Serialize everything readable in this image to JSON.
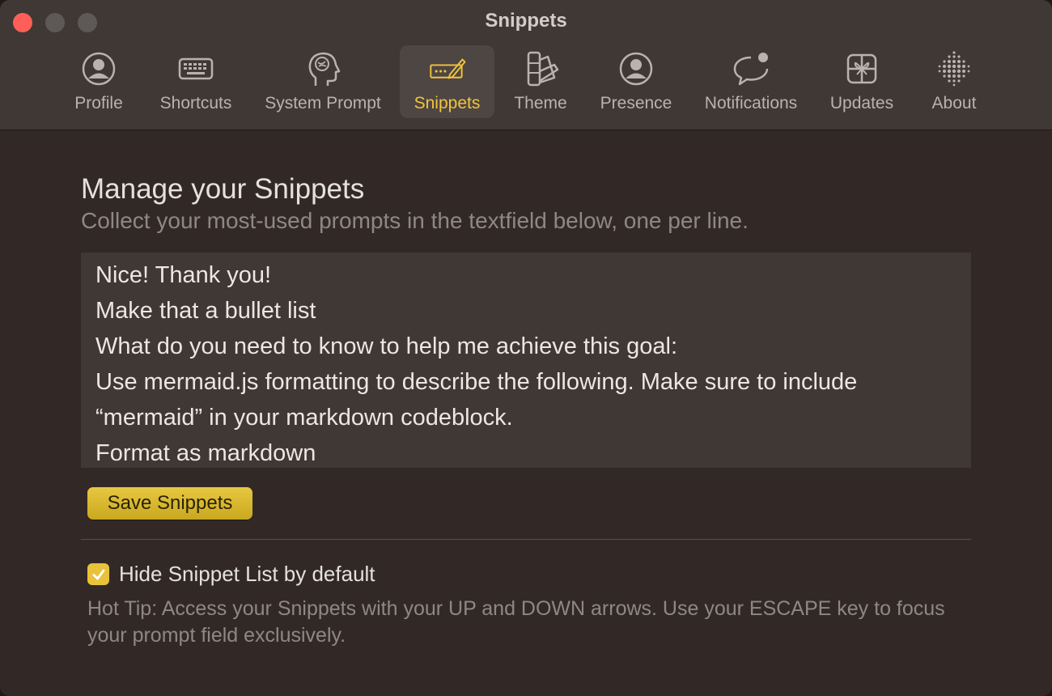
{
  "window": {
    "title": "Snippets"
  },
  "tabs": [
    {
      "label": "Profile",
      "icon": "person-circle-icon"
    },
    {
      "label": "Shortcuts",
      "icon": "keyboard-icon"
    },
    {
      "label": "System Prompt",
      "icon": "head-brain-icon"
    },
    {
      "label": "Snippets",
      "icon": "pen-text-icon",
      "active": true
    },
    {
      "label": "Theme",
      "icon": "swatches-icon"
    },
    {
      "label": "Presence",
      "icon": "person-circle-icon"
    },
    {
      "label": "Notifications",
      "icon": "chat-bubble-badge-icon"
    },
    {
      "label": "Updates",
      "icon": "gift-box-icon"
    },
    {
      "label": "About",
      "icon": "dots-sphere-icon"
    }
  ],
  "main": {
    "heading": "Manage your Snippets",
    "subheading": "Collect your most-used prompts in the textfield below, one per line.",
    "snippet_lines": [
      "Nice! Thank you!",
      "Make that a bullet list",
      "What do you need to know to help me achieve this goal:",
      "Use mermaid.js formatting to describe the following. Make sure to include",
      "“mermaid” in your markdown codeblock.",
      "Format as markdown"
    ],
    "save_label": "Save Snippets",
    "hide_list_label": "Hide Snippet List by default",
    "hide_list_checked": true,
    "hot_tip": "Hot Tip: Access your Snippets with your UP and DOWN arrows. Use your ESCAPE key to focus your prompt field exclusively."
  },
  "colors": {
    "accent": "#f2c43c",
    "window_bg": "#322927",
    "toolbar_bg": "#3f3835",
    "close_button": "#ff5f57"
  }
}
